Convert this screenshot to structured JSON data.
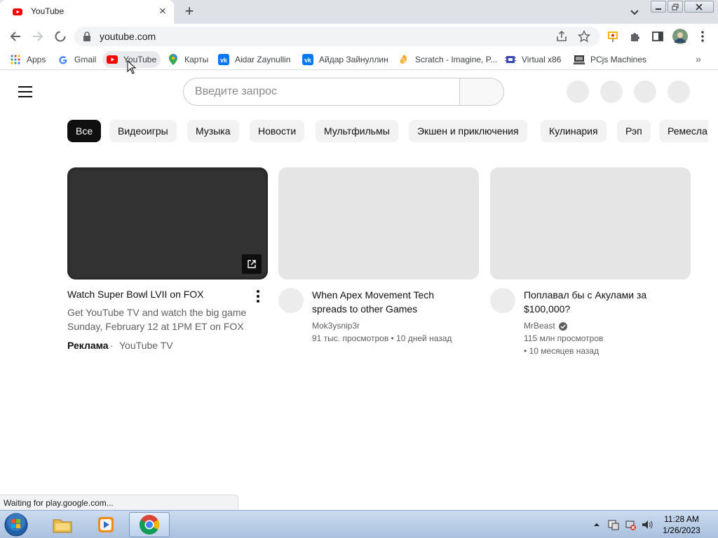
{
  "browser": {
    "tab_title": "YouTube",
    "url": "youtube.com",
    "status_text": "Waiting for play.google.com..."
  },
  "bookmarks": [
    {
      "label": "Apps",
      "icon": "apps-grid-icon"
    },
    {
      "label": "Gmail",
      "icon": "google-icon"
    },
    {
      "label": "YouTube",
      "icon": "youtube-icon"
    },
    {
      "label": "Карты",
      "icon": "maps-pin-icon"
    },
    {
      "label": "Aidar Zaynullin",
      "icon": "vk-icon"
    },
    {
      "label": "Айдар Зайнуллин",
      "icon": "vk-icon"
    },
    {
      "label": "Scratch - Imagine, P...",
      "icon": "scratch-icon"
    },
    {
      "label": "Virtual x86",
      "icon": "virtual-x86-icon"
    },
    {
      "label": "PCjs Machines",
      "icon": "pcjs-icon"
    }
  ],
  "youtube": {
    "search_placeholder": "Введите запрос",
    "chips": [
      "Все",
      "Видеоигры",
      "Музыка",
      "Новости",
      "Мультфильмы",
      "Экшен и приключения",
      "Кулинария",
      "Рэп",
      "Ремесла"
    ],
    "videos": [
      {
        "title": "Watch Super Bowl LVII on FOX",
        "description_line1": "Get YouTube TV and watch the big game",
        "description_line2": "Sunday, February 12 at 1PM ET on FOX",
        "ad_label": "Реклама",
        "advertiser": "YouTube TV"
      },
      {
        "title_line1": "When Apex Movement Tech",
        "title_line2": "spreads to other Games",
        "channel": "Mok3ysnip3r",
        "meta": "91 тыс. просмотров • 10 дней назад"
      },
      {
        "title_line1": "Поплавал бы с Акулами за",
        "title_line2": "$100,000?",
        "channel": "MrBeast",
        "meta_line1": "115 млн просмотров",
        "meta_line2": "• 10 месяцев назад"
      }
    ]
  },
  "taskbar": {
    "time": "11:28 AM",
    "date": "1/26/2023"
  },
  "colors": {
    "youtube_red": "#ff0000",
    "chip_active": "#0f0f0f",
    "chip_inactive": "#f2f2f2",
    "placeholder_grey": "#e5e5e5"
  }
}
